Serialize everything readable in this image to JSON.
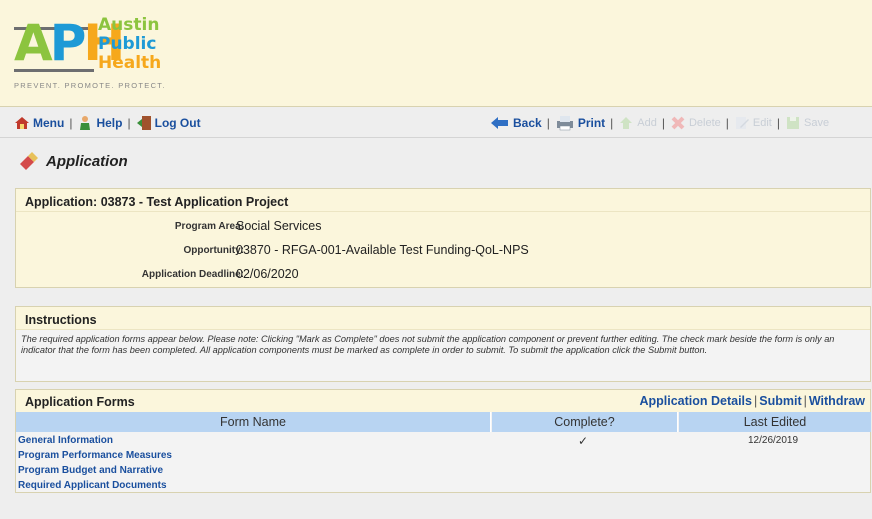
{
  "logo": {
    "line1": "Austin",
    "line2": "Public",
    "line3": "Health",
    "tagline": "PREVENT. PROMOTE. PROTECT."
  },
  "toolbar": {
    "menu_label": "Menu",
    "help_label": "Help",
    "logout_label": "Log Out",
    "back_label": "Back",
    "print_label": "Print",
    "add_label": "Add",
    "delete_label": "Delete",
    "edit_label": "Edit",
    "save_label": "Save"
  },
  "page": {
    "title": "Application"
  },
  "application": {
    "heading": "Application: 03873 - Test Application Project",
    "fields": [
      {
        "label": "Program Area:",
        "value": "Social Services"
      },
      {
        "label": "Opportunity:",
        "value": "03870 - RFGA-001-Available Test Funding-QoL-NPS"
      },
      {
        "label": "Application Deadline:",
        "value": "02/06/2020"
      }
    ]
  },
  "instructions": {
    "heading": "Instructions",
    "text": "The required application forms appear below. Please note: Clicking \"Mark as Complete\" does not submit the application component or prevent further editing. The check mark beside the form is only an indicator that the form has been completed. All application components must be marked as complete in order to submit. To submit the application click the Submit button."
  },
  "forms": {
    "heading": "Application Forms",
    "links": {
      "details": "Application Details",
      "submit": "Submit",
      "withdraw": "Withdraw"
    },
    "columns": [
      "Form Name",
      "Complete?",
      "Last Edited"
    ],
    "rows": [
      {
        "name": "General Information",
        "complete": "✓",
        "last_edited": "12/26/2019"
      },
      {
        "name": "Program Performance Measures",
        "complete": "",
        "last_edited": ""
      },
      {
        "name": "Program Budget and Narrative",
        "complete": "",
        "last_edited": ""
      },
      {
        "name": "Required Applicant Documents",
        "complete": "",
        "last_edited": ""
      }
    ]
  },
  "colors": {
    "link": "#1a4f9e",
    "panel_bg": "#fbf6dc",
    "column_header_bg": "#b8d4f2",
    "logo_green": "#8cc43f",
    "logo_blue": "#1e9ad6",
    "logo_orange": "#f6a81c"
  }
}
